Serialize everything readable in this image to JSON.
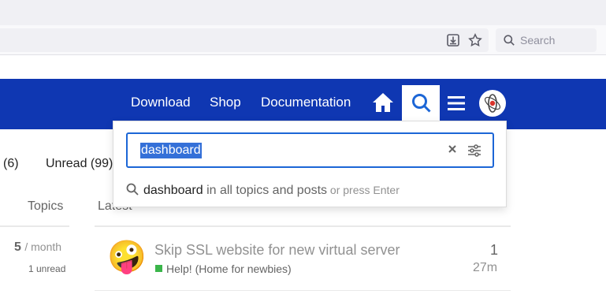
{
  "browser": {
    "search_placeholder": "Search",
    "icons": [
      "download-icon",
      "star-icon",
      "search-icon"
    ]
  },
  "header": {
    "nav": [
      "Download",
      "Shop",
      "Documentation"
    ],
    "icons": [
      "home-icon",
      "search-icon",
      "hamburger-menu-icon",
      "avatar"
    ],
    "brand_color": "#0f37b2"
  },
  "filters": {
    "new_partial": "(6)",
    "unread": "Unread (99)"
  },
  "columns": {
    "topics": "Topics",
    "latest": "Latest"
  },
  "category_stats": {
    "count": "5",
    "period": "/ month",
    "unread": "1 unread"
  },
  "topic": {
    "title": "Skip SSL website for new virtual server",
    "category": "Help! (Home for newbies)",
    "category_color": "#3ab54a",
    "replies": "1",
    "age": "27m",
    "emoji": "🤪"
  },
  "search": {
    "query": "dashboard",
    "suggestion_term": "dashboard",
    "suggestion_context": " in all topics and posts",
    "suggestion_hint": " or press Enter",
    "accent": "#1c66d6"
  }
}
